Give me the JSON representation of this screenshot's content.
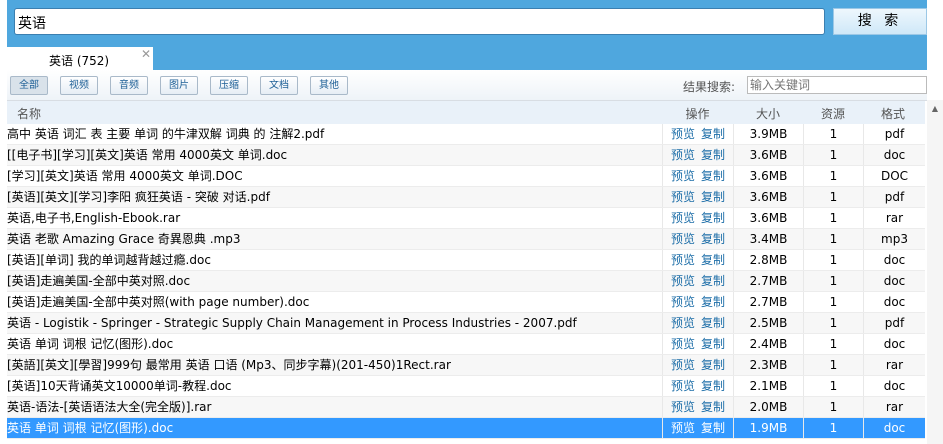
{
  "search": {
    "value": "英语",
    "button": "搜 索"
  },
  "tab": {
    "label": "英语 (752)",
    "close": "✕"
  },
  "filters": [
    "全部",
    "视频",
    "音频",
    "图片",
    "压缩",
    "文档",
    "其他"
  ],
  "result_search": {
    "label": "结果搜索:",
    "placeholder": "输入关键词"
  },
  "columns": {
    "name": "名称",
    "ops": "操作",
    "size": "大小",
    "source": "资源",
    "format": "格式"
  },
  "ops": {
    "preview": "预览",
    "copy": "复制"
  },
  "rows": [
    {
      "name": "高中 英语 词汇 表 主要 单词 的牛津双解 词典 的 注解2.pdf",
      "size": "3.9MB",
      "source": "1",
      "format": "pdf"
    },
    {
      "name": "[[电子书][学习][英文]英语 常用 4000英文 单词.doc",
      "size": "3.6MB",
      "source": "1",
      "format": "doc"
    },
    {
      "name": "[学习][英文]英语 常用 4000英文 单词.DOC",
      "size": "3.6MB",
      "source": "1",
      "format": "DOC"
    },
    {
      "name": "[英语][英文][学习]李阳 疯狂英语 - 突破 对话.pdf",
      "size": "3.6MB",
      "source": "1",
      "format": "pdf"
    },
    {
      "name": "英语,电子书,English-Ebook.rar",
      "size": "3.6MB",
      "source": "1",
      "format": "rar"
    },
    {
      "name": "英语 老歌 Amazing Grace 奇異恩典 .mp3",
      "size": "3.4MB",
      "source": "1",
      "format": "mp3"
    },
    {
      "name": "[英语][单词] 我的单词越背越过瘾.doc",
      "size": "2.8MB",
      "source": "1",
      "format": "doc"
    },
    {
      "name": "[英语]走遍美国-全部中英对照.doc",
      "size": "2.7MB",
      "source": "1",
      "format": "doc"
    },
    {
      "name": "[英语]走遍美国-全部中英对照(with page number).doc",
      "size": "2.7MB",
      "source": "1",
      "format": "doc"
    },
    {
      "name": "英语 - Logistik - Springer - Strategic Supply Chain Management in Process Industries - 2007.pdf",
      "size": "2.5MB",
      "source": "1",
      "format": "pdf"
    },
    {
      "name": "英语 单词 词根 记忆(图形).doc",
      "size": "2.4MB",
      "source": "1",
      "format": "doc"
    },
    {
      "name": "[英語][英文][學習]999句 最常用 英语 口语 (Mp3、同步字幕)(201-450)1Rect.rar",
      "size": "2.3MB",
      "source": "1",
      "format": "rar"
    },
    {
      "name": "[英语]10天背诵英文10000单词-教程.doc",
      "size": "2.1MB",
      "source": "1",
      "format": "doc"
    },
    {
      "name": "英语-语法-[英语语法大全(完全版)].rar",
      "size": "2.0MB",
      "source": "1",
      "format": "rar"
    },
    {
      "name": "英语 单词 词根 记忆(图形).doc",
      "size": "1.9MB",
      "source": "1",
      "format": "doc",
      "selected": true
    }
  ]
}
